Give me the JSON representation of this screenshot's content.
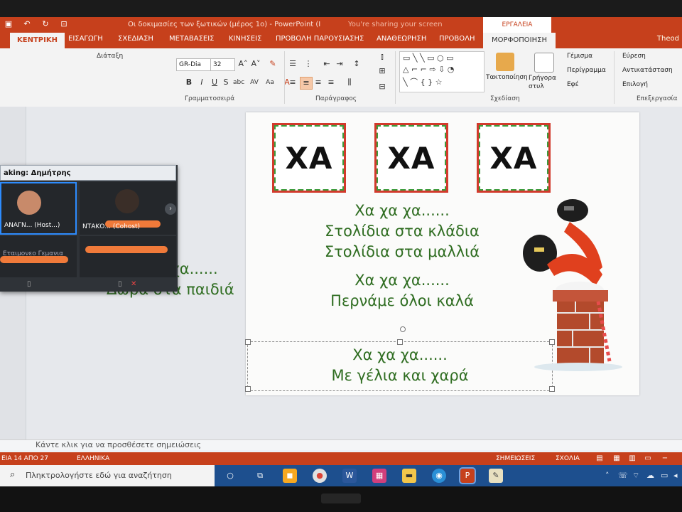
{
  "titlebar": {
    "doc_title": "Οι δοκιμασίες των ξωτικών (μέρος 1ο) - PowerPoint (Ι",
    "sharing": "You're sharing your screen",
    "tools_label": "ΕΡΓΑΛΕΙΑ ΣΧΕΔΙΑΣΗΣ"
  },
  "tabs": [
    "ΚΕΝΤΡΙΚΗ",
    "ΕΙΣΑΓΩΓΗ",
    "ΣΧΕΔΙΑΣΗ",
    "ΜΕΤΑΒΑΣΕΙΣ",
    "ΚΙΝΗΣΕΙΣ",
    "ΠΡΟΒΟΛΗ ΠΑΡΟΥΣΙΑΣΗΣ",
    "ΑΝΑΘΕΩΡΗΣΗ",
    "ΠΡΟΒΟΛΗ",
    "ΜΟΡΦΟΠΟΙΗΣΗ",
    "Theod"
  ],
  "ribbon": {
    "font_name": "GR-Dia",
    "font_size": "32",
    "layout_button": "Διάταξη",
    "groups": {
      "font": "Γραμματοσειρά",
      "paragraph": "Παράγραφος",
      "drawing": "Σχεδίαση",
      "editing": "Επεξεργασία"
    },
    "arrange": "Τακτοποίηση",
    "quick_styles": "Γρήγορα στυλ",
    "shape_fill": "Γέμισμα",
    "shape_outline": "Περίγραμμα",
    "shape_effects": "Εφέ",
    "find": "Εύρεση",
    "replace": "Αντικατάσταση",
    "select": "Επιλογή"
  },
  "zoom_panel": {
    "speaking": "aking: Δημήτρης",
    "tile1_name": "ΑΝΑΓΝ... (Host...)",
    "tile2_name": "ΝΤΑΚΟ... (Cohost)",
    "tile3_name": "Εταιμονεο Γεμανια"
  },
  "slide": {
    "ha_boxes": [
      "ΧΑ",
      "ΧΑ",
      "ΧΑ"
    ],
    "verse_main": [
      "Χα χα χα......",
      "Στολίδια στα κλάδια",
      "Στολίδια στα μαλλιά"
    ],
    "verse_second": [
      "Χα χα χα......",
      "Περνάμε όλοι καλά"
    ],
    "verse_selected": [
      "Χα χα χα......",
      "Με γέλια και χαρά"
    ],
    "verse_left": [
      "Χα χα χα......",
      "Δώρα στα παιδιά"
    ]
  },
  "notes_placeholder": "Κάντε κλικ για να προσθέσετε σημειώσεις",
  "status": {
    "slide_info": "ΕΙΑ 14 ΑΠΟ 27",
    "language": "ΕΛΛΗΝΙΚΑ",
    "notes": "ΣΗΜΕΙΩΣΕΙΣ",
    "comments": "ΣΧΟΛΙΑ"
  },
  "taskbar": {
    "search_placeholder": "Πληκτρολογήστε εδώ για αναζήτηση"
  },
  "colors": {
    "accent": "#c6401c",
    "verse_green": "#2f6d21",
    "taskbar": "#1d4f8e"
  }
}
